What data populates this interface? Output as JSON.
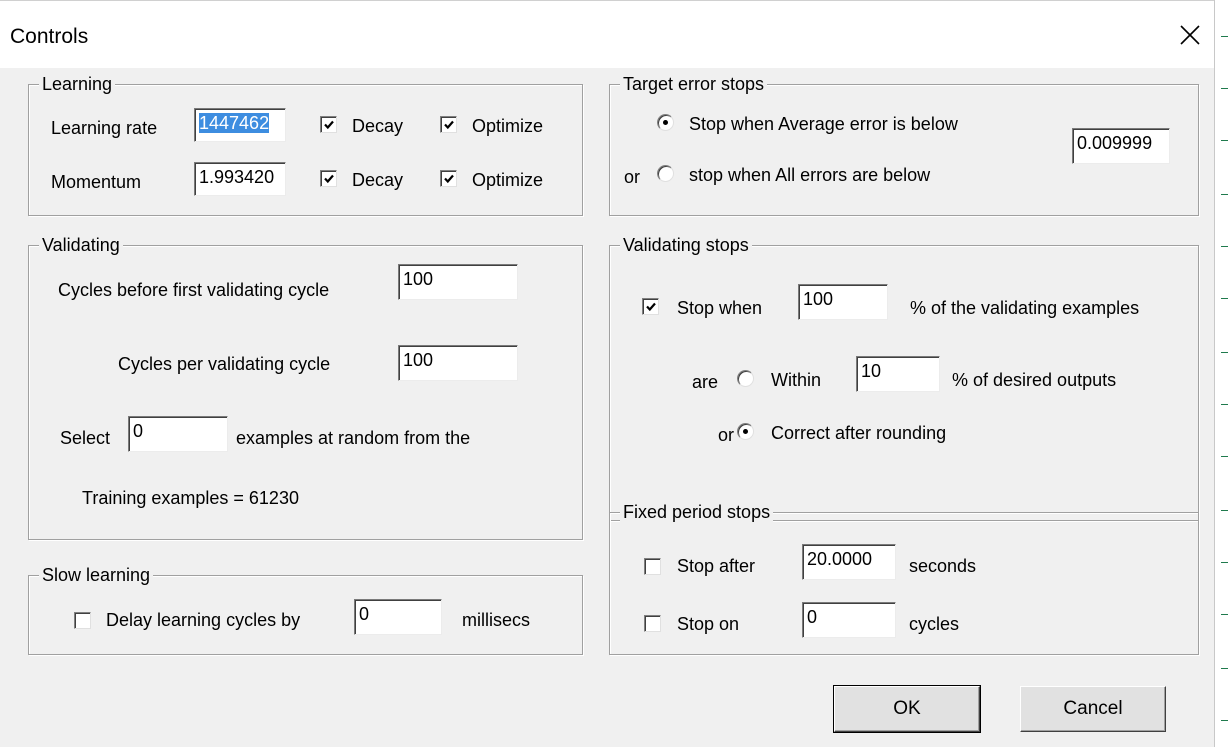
{
  "window": {
    "title": "Controls",
    "close_icon": "close-icon"
  },
  "learning": {
    "group_title": "Learning",
    "learning_rate_label": "Learning rate",
    "learning_rate_value": "1447462",
    "momentum_label": "Momentum",
    "momentum_value": "1.993420",
    "decay_label": "Decay",
    "optimize_label": "Optimize",
    "lr_decay_checked": true,
    "lr_optimize_checked": true,
    "mom_decay_checked": true,
    "mom_optimize_checked": true
  },
  "validating": {
    "group_title": "Validating",
    "cycles_before_label": "Cycles before first validating cycle",
    "cycles_before_value": "100",
    "cycles_per_label": "Cycles per validating cycle",
    "cycles_per_value": "100",
    "select_label": "Select",
    "select_value": "0",
    "random_label": "examples at random from the",
    "training_examples": "Training examples = 61230"
  },
  "slow_learning": {
    "group_title": "Slow learning",
    "delay_label": "Delay learning cycles by",
    "delay_value": "0",
    "millisecs_label": "millisecs",
    "delay_checked": false
  },
  "target_error": {
    "group_title": "Target error stops",
    "average_label": "Stop when Average error is below",
    "or_label": "or",
    "all_label": "stop when All errors are below",
    "value": "0.009999",
    "average_selected": true
  },
  "validating_stops": {
    "group_title": "Validating stops",
    "stop_when_label": "Stop when",
    "stop_when_value": "100",
    "pct_examples_label": "% of the validating examples",
    "are_label": "are",
    "within_label": "Within",
    "within_value": "10",
    "pct_desired_label": "% of desired outputs",
    "or_label": "or",
    "correct_label": "Correct after rounding",
    "stop_when_checked": true,
    "correct_selected": true
  },
  "fixed_period": {
    "group_title": "Fixed period stops",
    "stop_after_label": "Stop after",
    "stop_after_value": "20.0000",
    "seconds_label": "seconds",
    "stop_on_label": "Stop on",
    "stop_on_value": "0",
    "cycles_label": "cycles",
    "stop_after_checked": false,
    "stop_on_checked": false
  },
  "buttons": {
    "ok": "OK",
    "cancel": "Cancel"
  },
  "colors": {
    "dialog_face": "#f0f0f0",
    "selection": "#3d8de0"
  }
}
